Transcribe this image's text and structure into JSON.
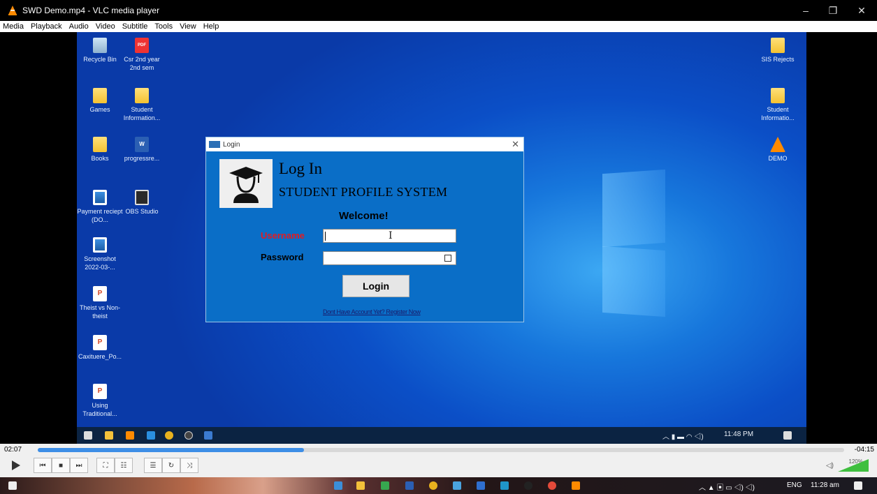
{
  "window": {
    "title": "SWD Demo.mp4 - VLC media player",
    "minimize": "–",
    "restore": "❐",
    "close": "✕"
  },
  "menu": [
    "Media",
    "Playback",
    "Audio",
    "Video",
    "Subtitle",
    "Tools",
    "View",
    "Help"
  ],
  "desktop_icons": [
    {
      "label": "Recycle Bin",
      "kind": "bin"
    },
    {
      "label": "Csr 2nd year 2nd sem",
      "kind": "pdf"
    },
    {
      "label": "Games",
      "kind": "folder"
    },
    {
      "label": "Student Information...",
      "kind": "folder"
    },
    {
      "label": "Books",
      "kind": "folder"
    },
    {
      "label": "progressre...",
      "kind": "word"
    },
    {
      "label": "Payment reciept (DO...",
      "kind": "img"
    },
    {
      "label": "OBS Studio",
      "kind": "obs"
    },
    {
      "label": "Screenshot 2022-03-...",
      "kind": "img"
    },
    {
      "label": "Theist vs Non-theist",
      "kind": "ppt"
    },
    {
      "label": "Caxituere_Po...",
      "kind": "ppt"
    },
    {
      "label": "Using Traditional...",
      "kind": "ppt"
    },
    {
      "label": "SIS Rejects",
      "kind": "folder"
    },
    {
      "label": "Student Informatio...",
      "kind": "folder"
    },
    {
      "label": "DEMO",
      "kind": "vlc"
    }
  ],
  "pdf_badge": "PDF",
  "word_badge": "W",
  "ppt_badge": "P",
  "login": {
    "window_title": "Login",
    "close": "✕",
    "heading": "Log In",
    "system_name": "STUDENT PROFILE SYSTEM",
    "welcome": "Welcome!",
    "username_label": "Username",
    "username_value": "",
    "password_label": "Password",
    "password_value": "",
    "login_button": "Login",
    "register_link": "Dont Have Account Yet? Register Now",
    "username_color": "#e11b22"
  },
  "inner_taskbar": {
    "time": "11:48 PM"
  },
  "player": {
    "elapsed": "02:07",
    "remaining": "-04:15",
    "progress": 0.33,
    "volume": "120%"
  },
  "outer_taskbar": {
    "lang": "ENG",
    "time": "11:28 am"
  }
}
